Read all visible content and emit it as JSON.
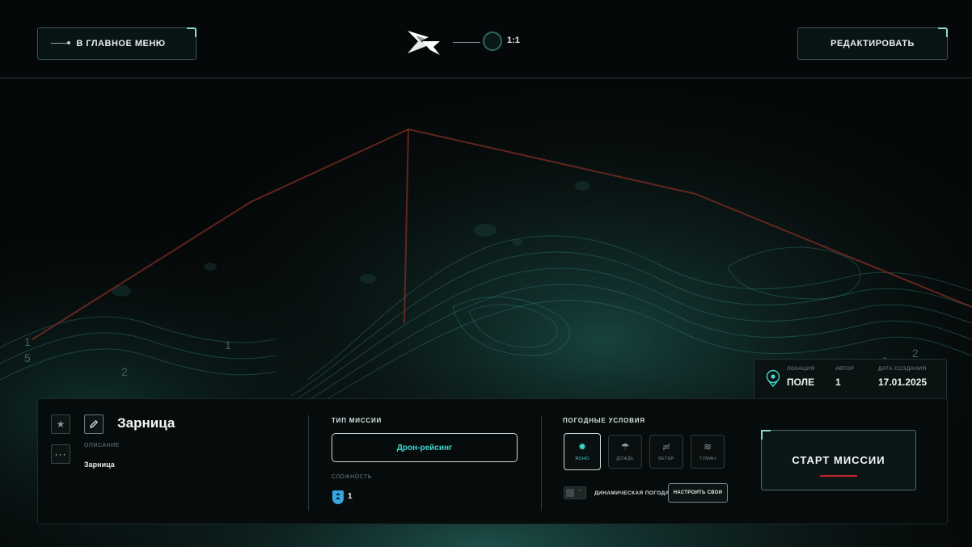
{
  "header": {
    "main_menu_label": "В ГЛАВНОЕ МЕНЮ",
    "edit_label": "РЕДАКТИРОВАТЬ",
    "player_count": "1:1"
  },
  "map": {
    "labels": [
      "1",
      "1",
      "5",
      "2",
      "2",
      "6"
    ]
  },
  "info": {
    "location_title": "ЛОКАЦИЯ",
    "location_value": "ПОЛЕ",
    "author_title": "АВТОР",
    "author_value": "1",
    "date_title": "ДАТА СОЗДАНИЯ",
    "date_value": "17.01.2025"
  },
  "mission": {
    "name": "Зарница",
    "description_title": "ОПИСАНИЕ",
    "description_value": "Зарница",
    "type_title": "ТИП МИССИИ",
    "type_value": "Дрон-рейсинг",
    "difficulty_title": "СЛОЖНОСТЬ",
    "difficulty_value": "1"
  },
  "weather": {
    "title": "ПОГОДНЫЕ УСЛОВИЯ",
    "options": [
      {
        "label": "ЯСНО",
        "icon": "sun-icon",
        "active": true
      },
      {
        "label": "ДОЖДЬ",
        "icon": "rain-icon",
        "active": false
      },
      {
        "label": "ВЕТЕР",
        "icon": "wind-icon",
        "active": false
      },
      {
        "label": "ТУМАН",
        "icon": "fog-icon",
        "active": false
      }
    ],
    "dynamic_label": "ДИНАМИЧЕСКАЯ ПОГОДА",
    "dynamic_enabled": false,
    "custom_label": "НАСТРОИТЬ СВОИ"
  },
  "start_label": "СТАРТ МИССИИ",
  "colors": {
    "accent": "#3fd8d0",
    "start_underline": "#c0252b",
    "difficulty_icon": "#35a8e0"
  }
}
